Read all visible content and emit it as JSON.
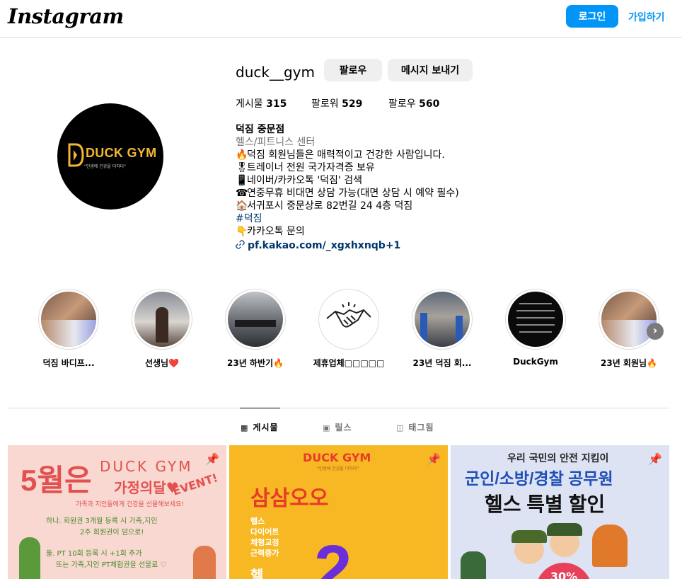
{
  "header": {
    "logo": "Instagram",
    "login_label": "로그인",
    "signup_label": "가입하기"
  },
  "profile": {
    "username": "duck__gym",
    "follow_label": "팔로우",
    "message_label": "메시지 보내기",
    "avatar": {
      "brand": "DUCK GYM",
      "slogan": "\"인생에 건강을 더하다\""
    },
    "stats": [
      {
        "label": "게시물",
        "value": "315"
      },
      {
        "label": "팔로워",
        "value": "529"
      },
      {
        "label": "팔로우",
        "value": "560"
      }
    ],
    "bio": {
      "name": "덕짐 중문점",
      "category": "헬스/피트니스 센터",
      "lines": [
        {
          "icon": "🔥",
          "text": "덕짐 회원님들은 매력적이고 건강한 사람입니다."
        },
        {
          "icon": "🎖",
          "text": "트레이너 전원 국가자격증 보유"
        },
        {
          "icon": "📱",
          "text": "네이버/카카오톡 '덕짐' 검색"
        },
        {
          "icon": "☎",
          "text": "연중무휴 비대면 상담 가능(대면 상담 시 예약 필수)"
        },
        {
          "icon": "🏠",
          "text": "서귀포시 중문상로 82번길 24 4층 덕짐"
        }
      ],
      "hashtag": "#덕짐",
      "kakao_line": {
        "icon": "👇",
        "text": "카카오톡 문의"
      },
      "link": "pf.kakao.com/_xgxhxnqb+1"
    }
  },
  "highlights": [
    {
      "label": "덕짐 바디프...",
      "icon": "photo-thumbnail-icon"
    },
    {
      "label": "선생님❤️",
      "icon": "photo-thumbnail-icon"
    },
    {
      "label": "23년 하반기🔥",
      "icon": "photo-thumbnail-icon"
    },
    {
      "label": "제휴업체□□□□□",
      "icon": "handshake-icon"
    },
    {
      "label": "23년 덕짐 회...",
      "icon": "photo-thumbnail-icon"
    },
    {
      "label": "DuckGym",
      "icon": "text-thumbnail-icon"
    },
    {
      "label": "23년 회원님🔥",
      "icon": "photo-thumbnail-icon"
    }
  ],
  "tabs": [
    {
      "label": "게시물",
      "icon": "grid-icon",
      "active": true
    },
    {
      "label": "릴스",
      "icon": "reels-icon",
      "active": false
    },
    {
      "label": "태그됨",
      "icon": "tag-icon",
      "active": false
    }
  ],
  "posts": [
    {
      "bg": "#f8d8d0",
      "headline": "5월은",
      "brand": "DUCK GYM",
      "subtitle": "가정의달♥",
      "event": "EVENT!",
      "small": "가족과 지인들에게 건강을 선물해보세요!",
      "line1": "하나. 회원권 3개월 등록 시 가족,지인",
      "line2": "2주 회원권이 덤으로!",
      "line3": "둘. PT 10회 등록 시 +1회 추가",
      "line4": "또는 가족,지인 PT체험권을 선물로 ♡"
    },
    {
      "bg": "#f7b823",
      "brand": "DUCK GYM",
      "slogan": "\"인생에 건강을 더하다\"",
      "headline": "삼삼오오",
      "items": [
        "헬스",
        "다이어트",
        "체형교정",
        "근력증가"
      ],
      "big": "2",
      "partial": "헬"
    },
    {
      "bg": "#dde3f2",
      "top": "우리 국민의 안전 지킴이",
      "headline": "군인/소방/경찰 공무원",
      "sub": "헬스 특별 할인",
      "badge": "30%"
    }
  ]
}
